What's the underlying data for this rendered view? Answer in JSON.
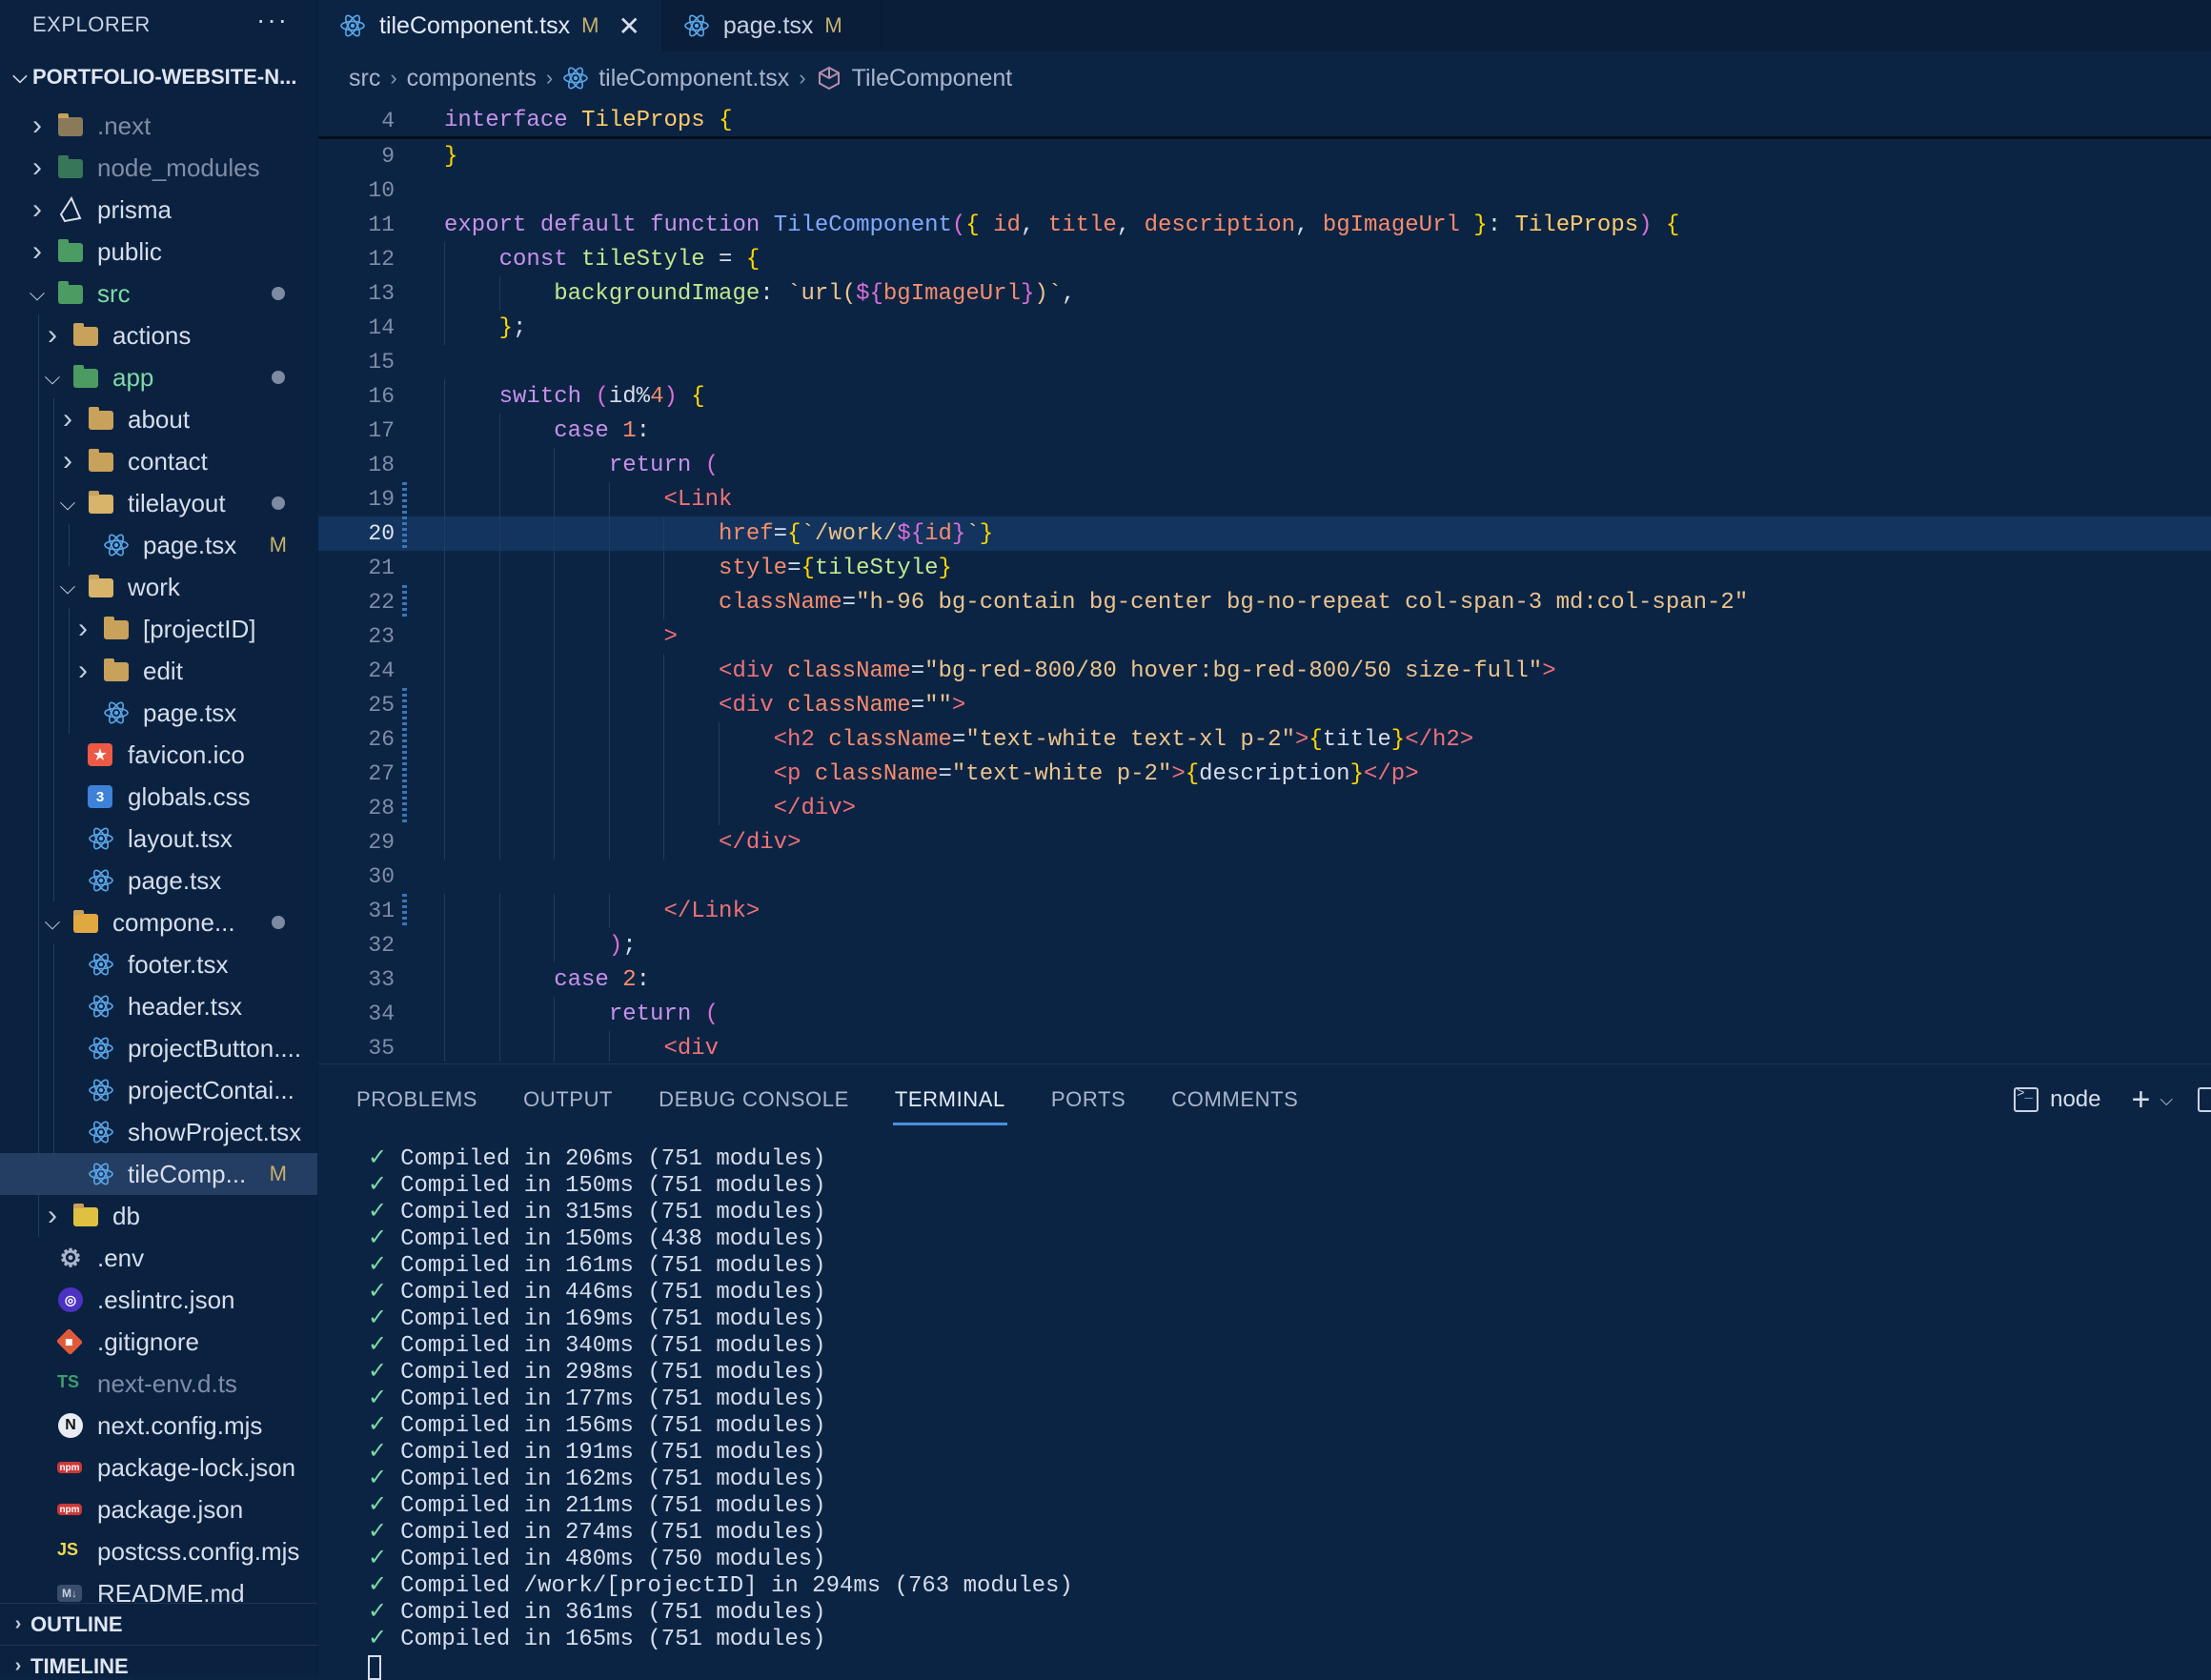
{
  "sidebar": {
    "title": "EXPLORER",
    "more": "···",
    "project": "PORTFOLIO-WEBSITE-N...",
    "items": [
      {
        "label": ".next",
        "status": ""
      },
      {
        "label": "node_modules",
        "status": ""
      },
      {
        "label": "prisma",
        "status": ""
      },
      {
        "label": "public",
        "status": ""
      },
      {
        "label": "src",
        "status": ""
      },
      {
        "label": "actions",
        "status": ""
      },
      {
        "label": "app",
        "status": ""
      },
      {
        "label": "about",
        "status": ""
      },
      {
        "label": "contact",
        "status": ""
      },
      {
        "label": "tilelayout",
        "status": ""
      },
      {
        "label": "page.tsx",
        "status": "M"
      },
      {
        "label": "work",
        "status": ""
      },
      {
        "label": "[projectID]",
        "status": ""
      },
      {
        "label": "edit",
        "status": ""
      },
      {
        "label": "page.tsx",
        "status": ""
      },
      {
        "label": "favicon.ico",
        "status": ""
      },
      {
        "label": "globals.css",
        "status": ""
      },
      {
        "label": "layout.tsx",
        "status": ""
      },
      {
        "label": "page.tsx",
        "status": ""
      },
      {
        "label": "compone...",
        "status": ""
      },
      {
        "label": "footer.tsx",
        "status": ""
      },
      {
        "label": "header.tsx",
        "status": ""
      },
      {
        "label": "projectButton....",
        "status": ""
      },
      {
        "label": "projectContai...",
        "status": ""
      },
      {
        "label": "showProject.tsx",
        "status": ""
      },
      {
        "label": "tileComp...",
        "status": "M"
      },
      {
        "label": "db",
        "status": ""
      },
      {
        "label": ".env",
        "status": ""
      },
      {
        "label": ".eslintrc.json",
        "status": ""
      },
      {
        "label": ".gitignore",
        "status": ""
      },
      {
        "label": "next-env.d.ts",
        "status": ""
      },
      {
        "label": "next.config.mjs",
        "status": ""
      },
      {
        "label": "package-lock.json",
        "status": ""
      },
      {
        "label": "package.json",
        "status": ""
      },
      {
        "label": "postcss.config.mjs",
        "status": ""
      },
      {
        "label": "README.md",
        "status": ""
      }
    ],
    "icon_badges": {
      "ts": "TS",
      "js": "JS",
      "css": "3",
      "next": "N",
      "md": "M↓",
      "npm": "npm"
    },
    "outline": "OUTLINE",
    "timeline": "TIMELINE"
  },
  "tabs": [
    {
      "label": "tileComponent.tsx",
      "status": "M",
      "close": "✕"
    },
    {
      "label": "page.tsx",
      "status": "M"
    }
  ],
  "breadcrumb": [
    "src",
    "components",
    "tileComponent.tsx",
    "TileComponent"
  ],
  "code": {
    "lines": [
      {
        "n": "4",
        "text": "interface TileProps {"
      },
      {
        "n": "9",
        "text": "}"
      },
      {
        "n": "10",
        "text": ""
      },
      {
        "n": "11",
        "text": "export default function TileComponent({ id, title, description, bgImageUrl }: TileProps) {"
      },
      {
        "n": "12",
        "text": "    const tileStyle = {"
      },
      {
        "n": "13",
        "text": "        backgroundImage: `url(${bgImageUrl})`,"
      },
      {
        "n": "14",
        "text": "    };"
      },
      {
        "n": "15",
        "text": ""
      },
      {
        "n": "16",
        "text": "    switch (id%4) {"
      },
      {
        "n": "17",
        "text": "        case 1:"
      },
      {
        "n": "18",
        "text": "            return ("
      },
      {
        "n": "19",
        "text": "                <Link"
      },
      {
        "n": "20",
        "text": "                    href={`/work/${id}`}"
      },
      {
        "n": "21",
        "text": "                    style={tileStyle}"
      },
      {
        "n": "22",
        "text": "                    className=\"h-96 bg-contain bg-center bg-no-repeat col-span-3 md:col-span-2\""
      },
      {
        "n": "23",
        "text": "                >"
      },
      {
        "n": "24",
        "text": "                    <div className=\"bg-red-800/80 hover:bg-red-800/50 size-full\">"
      },
      {
        "n": "25",
        "text": "                    <div className=\"\">"
      },
      {
        "n": "26",
        "text": "                        <h2 className=\"text-white text-xl p-2\">{title}</h2>"
      },
      {
        "n": "27",
        "text": "                        <p className=\"text-white p-2\">{description}</p>"
      },
      {
        "n": "28",
        "text": "                        </div>"
      },
      {
        "n": "29",
        "text": "                    </div>"
      },
      {
        "n": "30",
        "text": ""
      },
      {
        "n": "31",
        "text": "                </Link>"
      },
      {
        "n": "32",
        "text": "            );"
      },
      {
        "n": "33",
        "text": "        case 2:"
      },
      {
        "n": "34",
        "text": "            return ("
      },
      {
        "n": "35",
        "text": "                <div"
      }
    ]
  },
  "panel": {
    "tabs": [
      "PROBLEMS",
      "OUTPUT",
      "DEBUG CONSOLE",
      "TERMINAL",
      "PORTS",
      "COMMENTS"
    ],
    "active_tab": "TERMINAL",
    "shell": "node",
    "terminal_lines": [
      "Compiled in 206ms (751 modules)",
      "Compiled in 150ms (751 modules)",
      "Compiled in 315ms (751 modules)",
      "Compiled in 150ms (438 modules)",
      "Compiled in 161ms (751 modules)",
      "Compiled in 446ms (751 modules)",
      "Compiled in 169ms (751 modules)",
      "Compiled in 340ms (751 modules)",
      "Compiled in 298ms (751 modules)",
      "Compiled in 177ms (751 modules)",
      "Compiled in 156ms (751 modules)",
      "Compiled in 191ms (751 modules)",
      "Compiled in 162ms (751 modules)",
      "Compiled in 211ms (751 modules)",
      "Compiled in 274ms (751 modules)",
      "Compiled in 480ms (750 modules)",
      "Compiled /work/[projectID] in 294ms (763 modules)",
      "Compiled in 361ms (751 modules)",
      "Compiled in 165ms (751 modules)"
    ],
    "check": "✓"
  },
  "colors": {
    "background": "#0c2444",
    "sidebar": "#0b2140",
    "active_row": "#243d63",
    "accent": "#4a8fe0",
    "modified": "#c6b16b"
  }
}
